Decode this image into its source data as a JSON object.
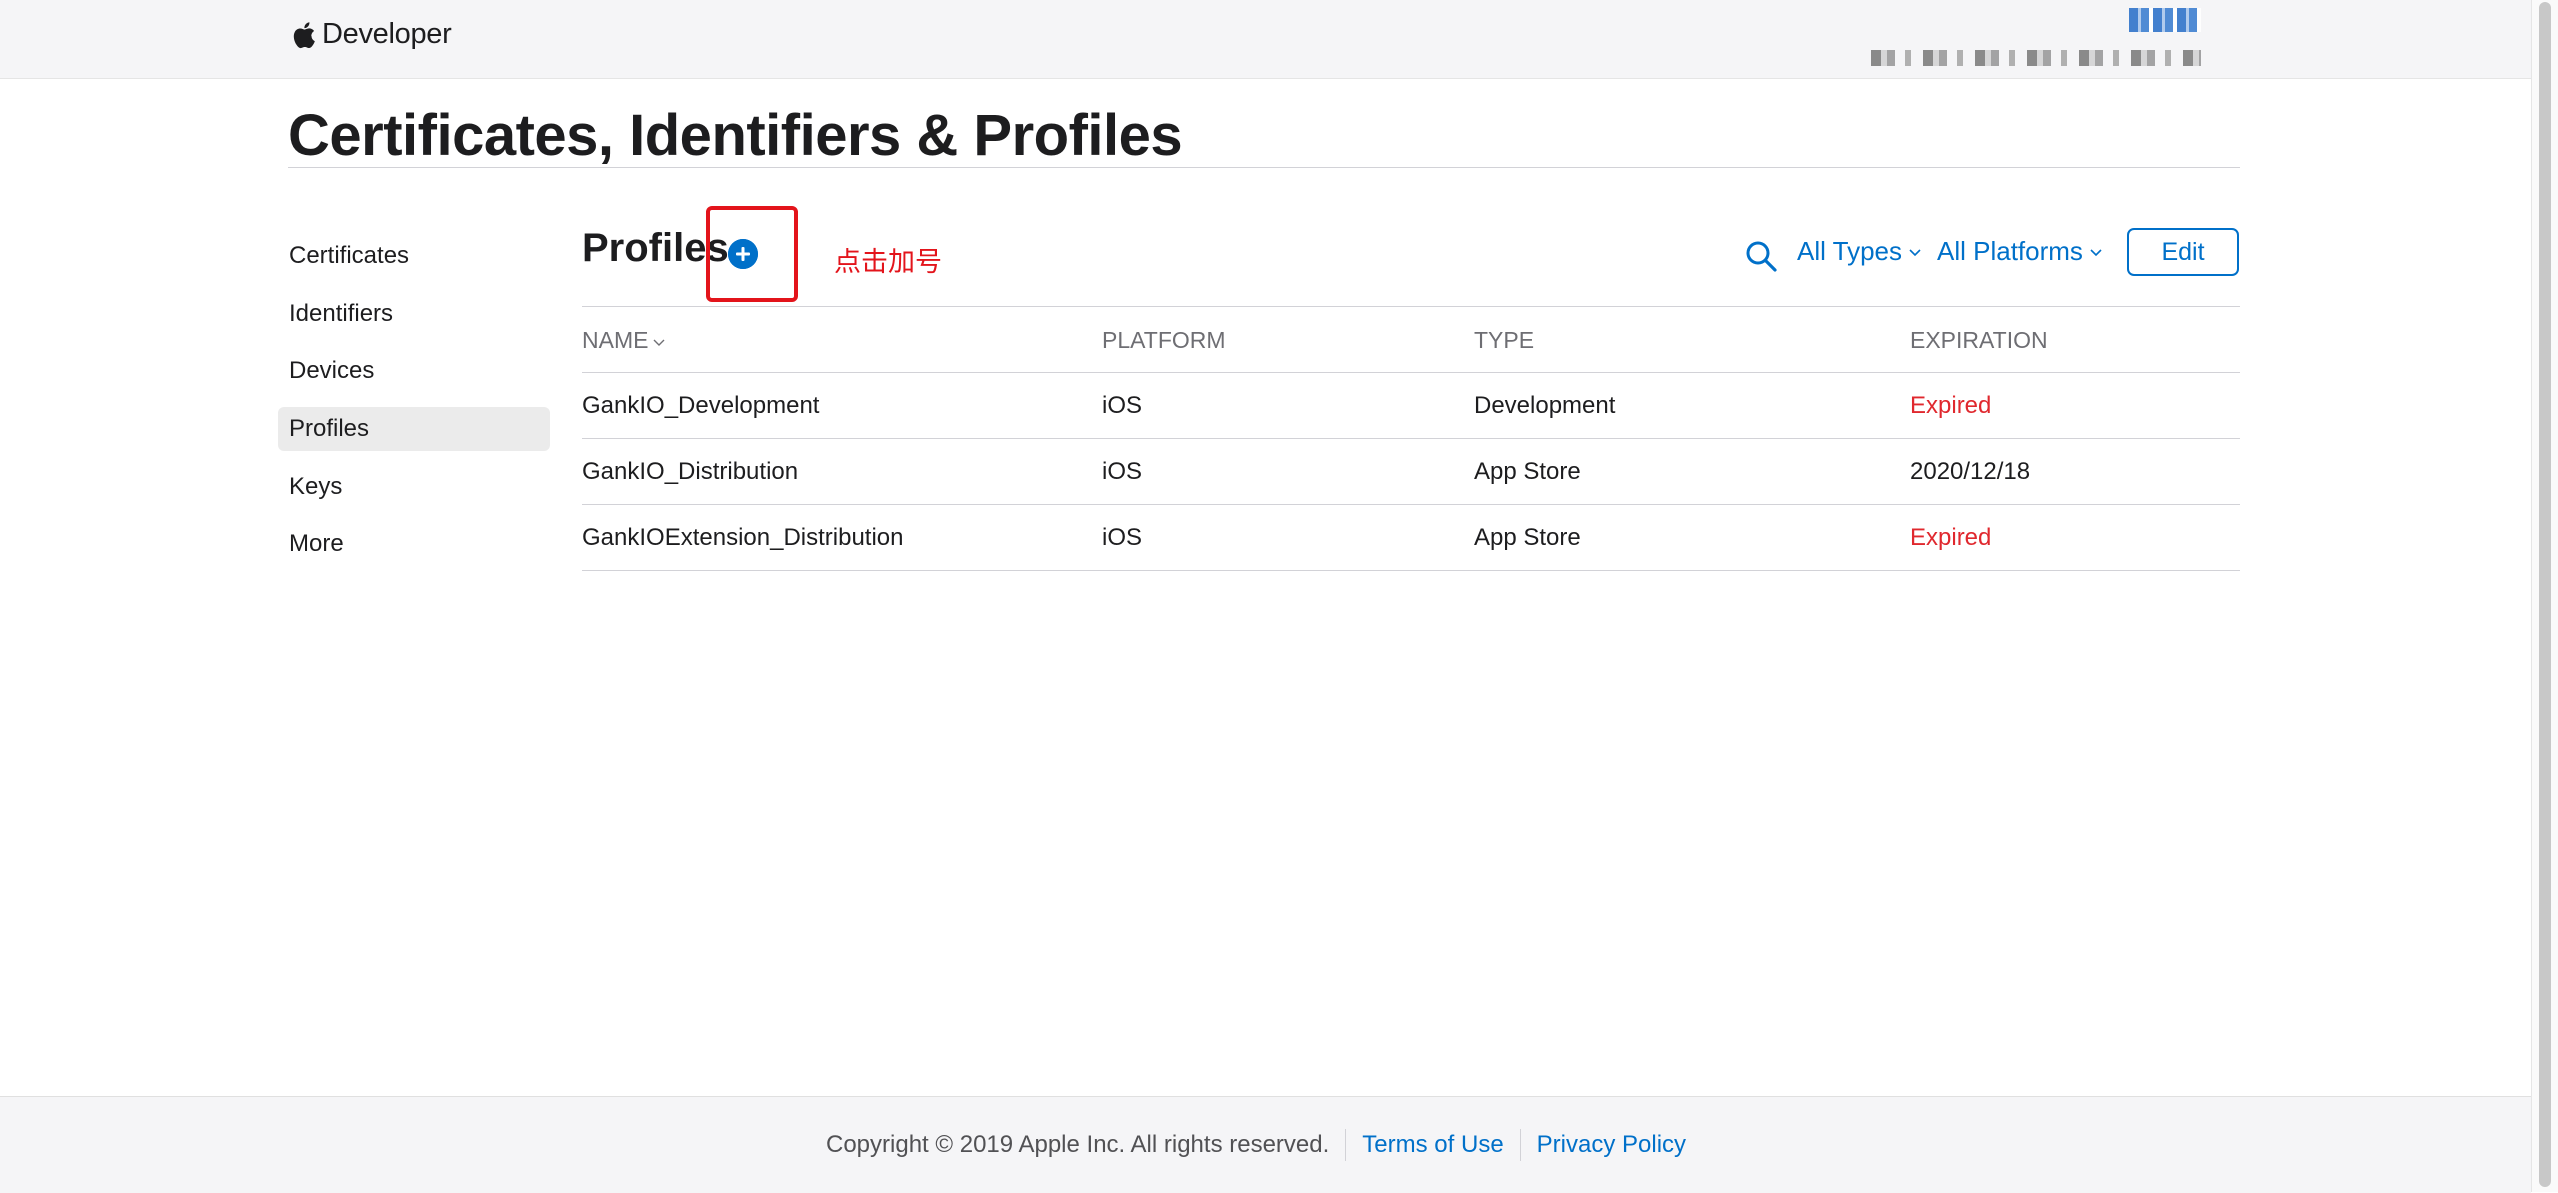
{
  "header": {
    "brand_label": "Developer",
    "brand_icon": "apple-logo-icon",
    "account_name_redacted": true
  },
  "page": {
    "title": "Certificates, Identifiers & Profiles"
  },
  "sidebar": {
    "items": [
      {
        "label": "Certificates",
        "active": false
      },
      {
        "label": "Identifiers",
        "active": false
      },
      {
        "label": "Devices",
        "active": false
      },
      {
        "label": "Profiles",
        "active": true
      },
      {
        "label": "Keys",
        "active": false
      },
      {
        "label": "More",
        "active": false
      }
    ]
  },
  "section": {
    "title": "Profiles",
    "add_icon": "plus-circle-icon",
    "annotation": "点击加号",
    "search_icon": "search-icon",
    "filter_types": "All Types",
    "filter_platforms": "All Platforms",
    "edit_label": "Edit"
  },
  "table": {
    "columns": [
      "NAME",
      "PLATFORM",
      "TYPE",
      "EXPIRATION"
    ],
    "rows": [
      {
        "name": "GankIO_Development",
        "platform": "iOS",
        "type": "Development",
        "expiration": "Expired",
        "expired": true
      },
      {
        "name": "GankIO_Distribution",
        "platform": "iOS",
        "type": "App Store",
        "expiration": "2020/12/18",
        "expired": false
      },
      {
        "name": "GankIOExtension_Distribution",
        "platform": "iOS",
        "type": "App Store",
        "expiration": "Expired",
        "expired": true
      }
    ]
  },
  "footer": {
    "copyright": "Copyright © 2019 Apple Inc. All rights reserved.",
    "terms": "Terms of Use",
    "privacy": "Privacy Policy"
  },
  "colors": {
    "accent": "#0070c9",
    "expired": "#e0282e",
    "annotation": "#e3141b"
  }
}
